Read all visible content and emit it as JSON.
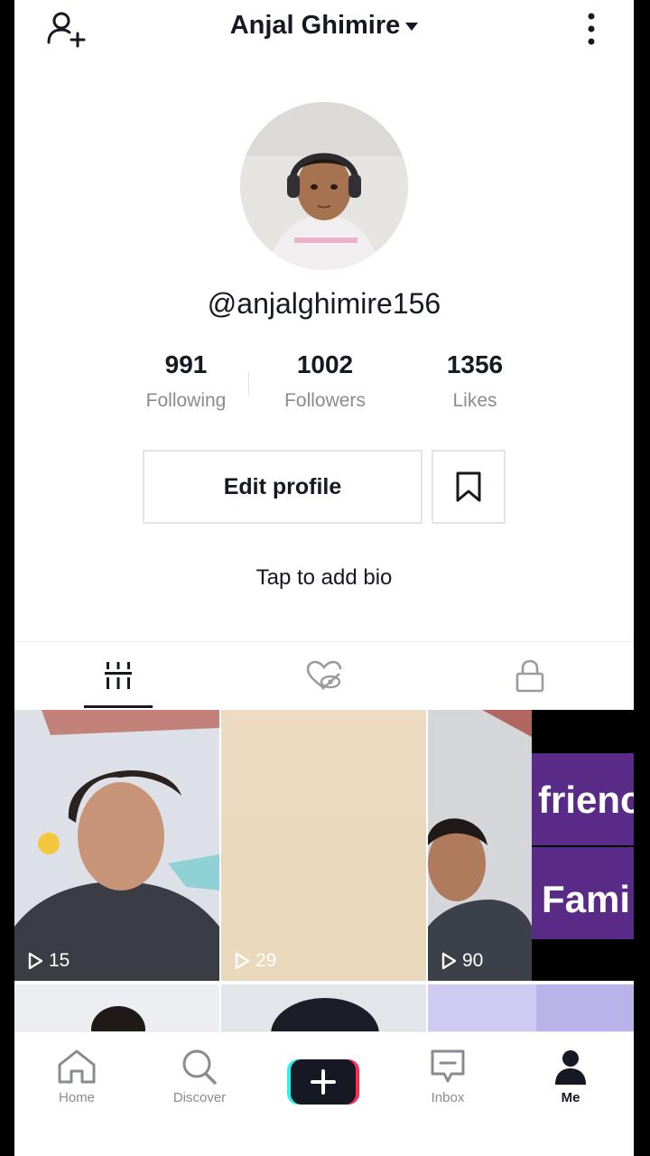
{
  "header": {
    "title": "Anjal Ghimire",
    "add_friend_icon": "person-plus-icon",
    "more_icon": "vertical-dots-icon"
  },
  "profile": {
    "handle": "@anjalghimire156",
    "bio_prompt": "Tap to add bio",
    "edit_label": "Edit profile",
    "bookmark_icon": "bookmark-icon"
  },
  "stats": [
    {
      "value": "991",
      "label": "Following"
    },
    {
      "value": "1002",
      "label": "Followers"
    },
    {
      "value": "1356",
      "label": "Likes"
    }
  ],
  "tabs": [
    {
      "icon": "grid-bars-icon",
      "active": true
    },
    {
      "icon": "hidden-heart-icon",
      "active": false
    },
    {
      "icon": "lock-icon",
      "active": false
    }
  ],
  "videos": [
    {
      "views": "15"
    },
    {
      "views": "29"
    },
    {
      "views": "90"
    }
  ],
  "video4_text": [
    "frienc",
    "Fami"
  ],
  "navbar": {
    "items": [
      {
        "label": "Home",
        "icon": "home-icon"
      },
      {
        "label": "Discover",
        "icon": "search-icon"
      },
      {
        "label": "",
        "icon": "plus-icon"
      },
      {
        "label": "Inbox",
        "icon": "message-icon"
      },
      {
        "label": "Me",
        "icon": "person-icon"
      }
    ]
  },
  "colors": {
    "text": "#161823",
    "muted": "#8a8b91",
    "accent_cyan": "#25f4ee",
    "accent_red": "#fe2c55",
    "purple_tile": "#5a2a87"
  }
}
